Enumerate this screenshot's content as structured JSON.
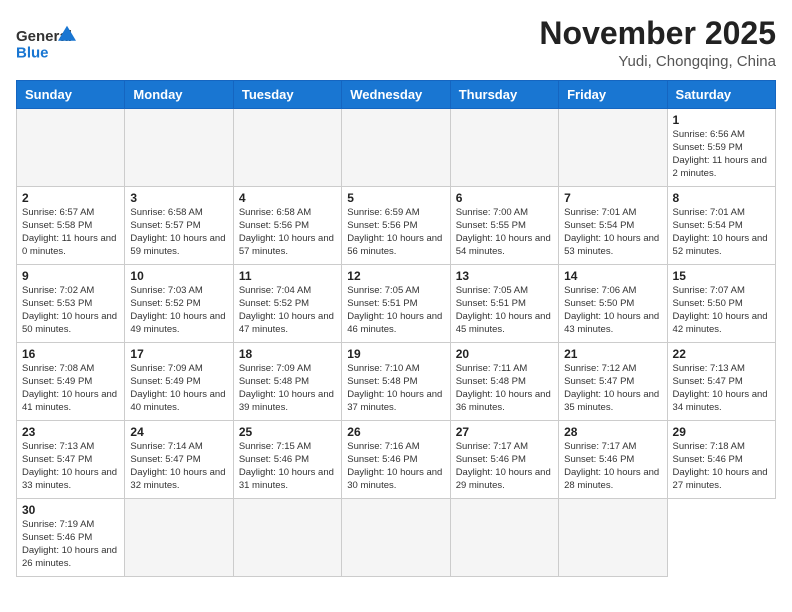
{
  "header": {
    "logo_general": "General",
    "logo_blue": "Blue",
    "month_year": "November 2025",
    "location": "Yudi, Chongqing, China"
  },
  "weekdays": [
    "Sunday",
    "Monday",
    "Tuesday",
    "Wednesday",
    "Thursday",
    "Friday",
    "Saturday"
  ],
  "days": [
    {
      "date": null,
      "info": ""
    },
    {
      "date": null,
      "info": ""
    },
    {
      "date": null,
      "info": ""
    },
    {
      "date": null,
      "info": ""
    },
    {
      "date": null,
      "info": ""
    },
    {
      "date": null,
      "info": ""
    },
    {
      "date": "1",
      "info": "Sunrise: 6:56 AM\nSunset: 5:59 PM\nDaylight: 11 hours and 2 minutes."
    },
    {
      "date": "2",
      "info": "Sunrise: 6:57 AM\nSunset: 5:58 PM\nDaylight: 11 hours and 0 minutes."
    },
    {
      "date": "3",
      "info": "Sunrise: 6:58 AM\nSunset: 5:57 PM\nDaylight: 10 hours and 59 minutes."
    },
    {
      "date": "4",
      "info": "Sunrise: 6:58 AM\nSunset: 5:56 PM\nDaylight: 10 hours and 57 minutes."
    },
    {
      "date": "5",
      "info": "Sunrise: 6:59 AM\nSunset: 5:56 PM\nDaylight: 10 hours and 56 minutes."
    },
    {
      "date": "6",
      "info": "Sunrise: 7:00 AM\nSunset: 5:55 PM\nDaylight: 10 hours and 54 minutes."
    },
    {
      "date": "7",
      "info": "Sunrise: 7:01 AM\nSunset: 5:54 PM\nDaylight: 10 hours and 53 minutes."
    },
    {
      "date": "8",
      "info": "Sunrise: 7:01 AM\nSunset: 5:54 PM\nDaylight: 10 hours and 52 minutes."
    },
    {
      "date": "9",
      "info": "Sunrise: 7:02 AM\nSunset: 5:53 PM\nDaylight: 10 hours and 50 minutes."
    },
    {
      "date": "10",
      "info": "Sunrise: 7:03 AM\nSunset: 5:52 PM\nDaylight: 10 hours and 49 minutes."
    },
    {
      "date": "11",
      "info": "Sunrise: 7:04 AM\nSunset: 5:52 PM\nDaylight: 10 hours and 47 minutes."
    },
    {
      "date": "12",
      "info": "Sunrise: 7:05 AM\nSunset: 5:51 PM\nDaylight: 10 hours and 46 minutes."
    },
    {
      "date": "13",
      "info": "Sunrise: 7:05 AM\nSunset: 5:51 PM\nDaylight: 10 hours and 45 minutes."
    },
    {
      "date": "14",
      "info": "Sunrise: 7:06 AM\nSunset: 5:50 PM\nDaylight: 10 hours and 43 minutes."
    },
    {
      "date": "15",
      "info": "Sunrise: 7:07 AM\nSunset: 5:50 PM\nDaylight: 10 hours and 42 minutes."
    },
    {
      "date": "16",
      "info": "Sunrise: 7:08 AM\nSunset: 5:49 PM\nDaylight: 10 hours and 41 minutes."
    },
    {
      "date": "17",
      "info": "Sunrise: 7:09 AM\nSunset: 5:49 PM\nDaylight: 10 hours and 40 minutes."
    },
    {
      "date": "18",
      "info": "Sunrise: 7:09 AM\nSunset: 5:48 PM\nDaylight: 10 hours and 39 minutes."
    },
    {
      "date": "19",
      "info": "Sunrise: 7:10 AM\nSunset: 5:48 PM\nDaylight: 10 hours and 37 minutes."
    },
    {
      "date": "20",
      "info": "Sunrise: 7:11 AM\nSunset: 5:48 PM\nDaylight: 10 hours and 36 minutes."
    },
    {
      "date": "21",
      "info": "Sunrise: 7:12 AM\nSunset: 5:47 PM\nDaylight: 10 hours and 35 minutes."
    },
    {
      "date": "22",
      "info": "Sunrise: 7:13 AM\nSunset: 5:47 PM\nDaylight: 10 hours and 34 minutes."
    },
    {
      "date": "23",
      "info": "Sunrise: 7:13 AM\nSunset: 5:47 PM\nDaylight: 10 hours and 33 minutes."
    },
    {
      "date": "24",
      "info": "Sunrise: 7:14 AM\nSunset: 5:47 PM\nDaylight: 10 hours and 32 minutes."
    },
    {
      "date": "25",
      "info": "Sunrise: 7:15 AM\nSunset: 5:46 PM\nDaylight: 10 hours and 31 minutes."
    },
    {
      "date": "26",
      "info": "Sunrise: 7:16 AM\nSunset: 5:46 PM\nDaylight: 10 hours and 30 minutes."
    },
    {
      "date": "27",
      "info": "Sunrise: 7:17 AM\nSunset: 5:46 PM\nDaylight: 10 hours and 29 minutes."
    },
    {
      "date": "28",
      "info": "Sunrise: 7:17 AM\nSunset: 5:46 PM\nDaylight: 10 hours and 28 minutes."
    },
    {
      "date": "29",
      "info": "Sunrise: 7:18 AM\nSunset: 5:46 PM\nDaylight: 10 hours and 27 minutes."
    },
    {
      "date": "30",
      "info": "Sunrise: 7:19 AM\nSunset: 5:46 PM\nDaylight: 10 hours and 26 minutes."
    },
    {
      "date": null,
      "info": ""
    },
    {
      "date": null,
      "info": ""
    },
    {
      "date": null,
      "info": ""
    },
    {
      "date": null,
      "info": ""
    },
    {
      "date": null,
      "info": ""
    }
  ]
}
